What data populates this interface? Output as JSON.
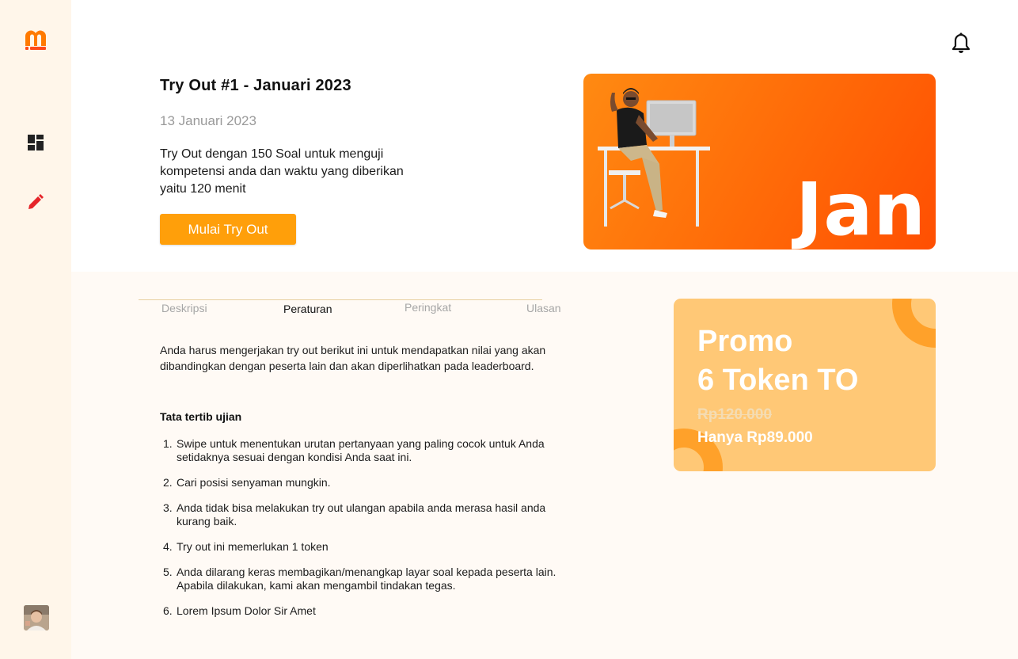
{
  "sidebar": {
    "logo": "m-logo",
    "items": [
      {
        "icon": "dashboard-icon"
      },
      {
        "icon": "pencil-icon"
      }
    ],
    "avatar": "user-avatar"
  },
  "header": {
    "notification_icon": "bell-icon"
  },
  "tryout": {
    "title": "Try Out #1 - Januari 2023",
    "date": "13 Januari 2023",
    "description": "Try Out dengan 150 Soal untuk menguji kompetensi anda dan waktu yang diberikan yaitu 120 menit",
    "start_label": "Mulai Try Out",
    "banner_month": "Jan"
  },
  "tabs": [
    {
      "label": "Deskripsi"
    },
    {
      "label": "Peraturan",
      "active": true
    },
    {
      "label": "Peringkat"
    },
    {
      "label": "Ulasan"
    }
  ],
  "content": {
    "intro": "Anda harus mengerjakan try out berikut ini untuk mendapatkan nilai yang akan dibandingkan dengan peserta lain dan akan diperlihatkan pada leaderboard.",
    "rules_title": "Tata tertib ujian",
    "rules": [
      {
        "num": "1.",
        "text": "Swipe untuk menentukan urutan pertanyaan yang paling cocok untuk Anda setidaknya sesuai dengan kondisi Anda saat ini."
      },
      {
        "num": "2.",
        "text": "Cari posisi senyaman mungkin."
      },
      {
        "num": "3.",
        "text": "Anda tidak bisa melakukan try out ulangan apabila anda merasa hasil anda kurang baik."
      },
      {
        "num": "4.",
        "text": "Try out ini memerlukan 1 token"
      },
      {
        "num": "5.",
        "text": "Anda dilarang keras membagikan/menangkap layar soal kepada peserta lain. Apabila dilakukan, kami akan mengambil tindakan tegas."
      },
      {
        "num": "6.",
        "text": "Lorem Ipsum Dolor Sir Amet"
      }
    ]
  },
  "promo": {
    "line1": "Promo",
    "line2": "6 Token TO",
    "old_price": "Rp120.000",
    "new_price": "Hanya Rp89.000"
  },
  "colors": {
    "accent": "#ff9f0a",
    "sidebar_bg": "#fff6ea",
    "promo_bg": "#ffc876",
    "promo_deco": "#ffa12a",
    "banner_start": "#ff8a12",
    "banner_end": "#ff4f02"
  }
}
